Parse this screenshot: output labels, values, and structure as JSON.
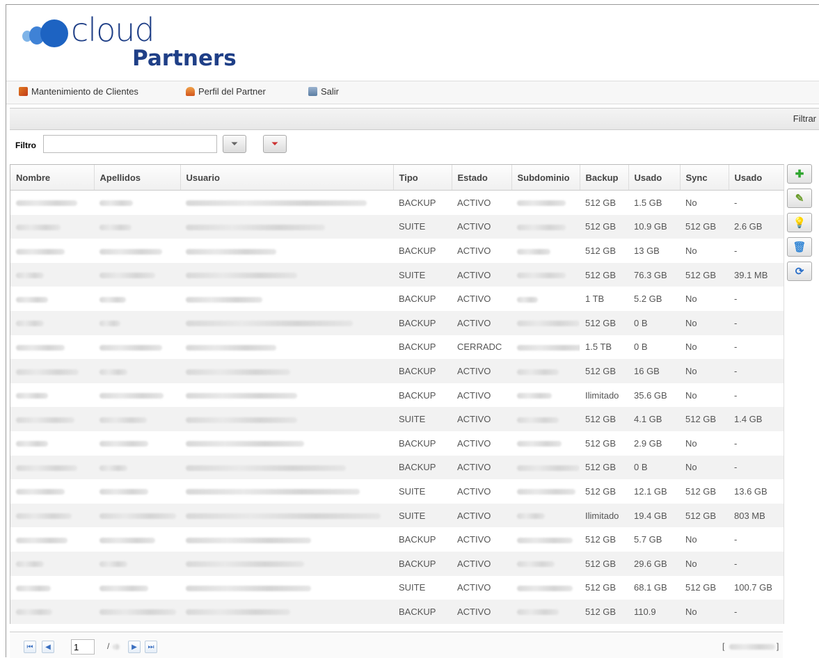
{
  "logo": {
    "word": "cloud",
    "sub": "Partners"
  },
  "menu": [
    {
      "label": "Mantenimiento de Clientes",
      "icon": "users-icon"
    },
    {
      "label": "Perfil del Partner",
      "icon": "user-icon"
    },
    {
      "label": "Salir",
      "icon": "exit-icon"
    }
  ],
  "toolbar": {
    "filtrar": "Filtrar"
  },
  "filter": {
    "label": "Filtro",
    "value": "",
    "apply_icon": "filter-icon",
    "clear_icon": "clear-filter-icon"
  },
  "columns": [
    "Nombre",
    "Apellidos",
    "Usuario",
    "Tipo",
    "Estado",
    "Subdominio",
    "Backup",
    "Usado",
    "Sync",
    "Usado"
  ],
  "rows": [
    {
      "tipo": "BACKUP",
      "estado": "ACTIVO",
      "backup": "512 GB",
      "usado": "1.5 GB",
      "sync": "No",
      "usado2": "-"
    },
    {
      "tipo": "SUITE",
      "estado": "ACTIVO",
      "backup": "512 GB",
      "usado": "10.9 GB",
      "sync": "512 GB",
      "usado2": "2.6 GB"
    },
    {
      "tipo": "BACKUP",
      "estado": "ACTIVO",
      "backup": "512 GB",
      "usado": "13 GB",
      "sync": "No",
      "usado2": "-"
    },
    {
      "tipo": "SUITE",
      "estado": "ACTIVO",
      "backup": "512 GB",
      "usado": "76.3 GB",
      "sync": "512 GB",
      "usado2": "39.1 MB"
    },
    {
      "tipo": "BACKUP",
      "estado": "ACTIVO",
      "backup": "1 TB",
      "usado": "5.2 GB",
      "sync": "No",
      "usado2": "-"
    },
    {
      "tipo": "BACKUP",
      "estado": "ACTIVO",
      "backup": "512 GB",
      "usado": "0 B",
      "sync": "No",
      "usado2": "-"
    },
    {
      "tipo": "BACKUP",
      "estado": "CERRADC",
      "backup": "1.5 TB",
      "usado": "0 B",
      "sync": "No",
      "usado2": "-"
    },
    {
      "tipo": "BACKUP",
      "estado": "ACTIVO",
      "backup": "512 GB",
      "usado": "16 GB",
      "sync": "No",
      "usado2": "-"
    },
    {
      "tipo": "BACKUP",
      "estado": "ACTIVO",
      "backup": "Ilimitado",
      "usado": "35.6 GB",
      "sync": "No",
      "usado2": "-"
    },
    {
      "tipo": "SUITE",
      "estado": "ACTIVO",
      "backup": "512 GB",
      "usado": "4.1 GB",
      "sync": "512 GB",
      "usado2": "1.4 GB"
    },
    {
      "tipo": "BACKUP",
      "estado": "ACTIVO",
      "backup": "512 GB",
      "usado": "2.9 GB",
      "sync": "No",
      "usado2": "-"
    },
    {
      "tipo": "BACKUP",
      "estado": "ACTIVO",
      "backup": "512 GB",
      "usado": "0 B",
      "sync": "No",
      "usado2": "-"
    },
    {
      "tipo": "SUITE",
      "estado": "ACTIVO",
      "backup": "512 GB",
      "usado": "12.1 GB",
      "sync": "512 GB",
      "usado2": "13.6 GB"
    },
    {
      "tipo": "SUITE",
      "estado": "ACTIVO",
      "backup": "Ilimitado",
      "usado": "19.4 GB",
      "sync": "512 GB",
      "usado2": "803 MB"
    },
    {
      "tipo": "BACKUP",
      "estado": "ACTIVO",
      "backup": "512 GB",
      "usado": "5.7 GB",
      "sync": "No",
      "usado2": "-"
    },
    {
      "tipo": "BACKUP",
      "estado": "ACTIVO",
      "backup": "512 GB",
      "usado": "29.6 GB",
      "sync": "No",
      "usado2": "-"
    },
    {
      "tipo": "SUITE",
      "estado": "ACTIVO",
      "backup": "512 GB",
      "usado": "68.1 GB",
      "sync": "512 GB",
      "usado2": "100.7 GB"
    },
    {
      "tipo": "BACKUP",
      "estado": "ACTIVO",
      "backup": "512 GB",
      "usado": "110.9",
      "sync": "No",
      "usado2": "-"
    }
  ],
  "side_buttons": [
    {
      "name": "add-icon",
      "glyph": "✚",
      "color": "#2fa52f"
    },
    {
      "name": "edit-icon",
      "glyph": "✎",
      "color": "#6a9c2a"
    },
    {
      "name": "lightbulb-icon",
      "glyph": "💡",
      "color": "#d8b800"
    },
    {
      "name": "recycle-bin-icon",
      "glyph": "🗑",
      "color": "#3a8ad6"
    },
    {
      "name": "refresh-icon",
      "glyph": "⟳",
      "color": "#2a6fc9"
    }
  ],
  "pager": {
    "page": "1",
    "of": "/"
  },
  "colors": {
    "brand": "#1f3f87",
    "accent": "#1d63c2",
    "row_alt": "#f2f2f2"
  }
}
